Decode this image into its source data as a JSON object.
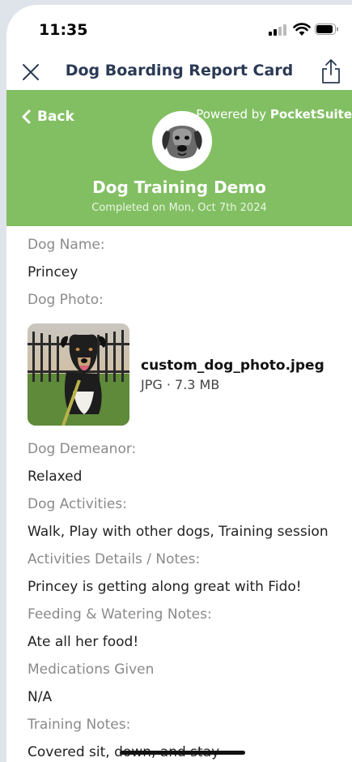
{
  "status": {
    "time": "11:35"
  },
  "nav": {
    "title": "Dog Boarding Report Card"
  },
  "header": {
    "back_label": "Back",
    "powered_prefix": "Powered by ",
    "powered_brand": "PocketSuite",
    "business_name": "Dog Training Demo",
    "completed": "Completed on Mon, Oct 7th 2024",
    "accent_color": "#82bf63"
  },
  "fields": {
    "dog_name_label": "Dog Name:",
    "dog_name": "Princey",
    "dog_photo_label": "Dog Photo:",
    "photo_file_name": "custom_dog_photo.jpeg",
    "photo_file_meta": "JPG · 7.3 MB",
    "demeanor_label": "Dog Demeanor:",
    "demeanor": "Relaxed",
    "activities_label": "Dog Activities:",
    "activities": "Walk, Play with other dogs, Training session",
    "activity_notes_label": "Activities Details / Notes:",
    "activity_notes": "Princey is getting along great with Fido!",
    "feeding_label": "Feeding & Watering Notes:",
    "feeding": "Ate all her food!",
    "medications_label": "Medications Given",
    "medications": "N/A",
    "training_label": "Training Notes:",
    "training": "Covered sit, down, and stay"
  }
}
